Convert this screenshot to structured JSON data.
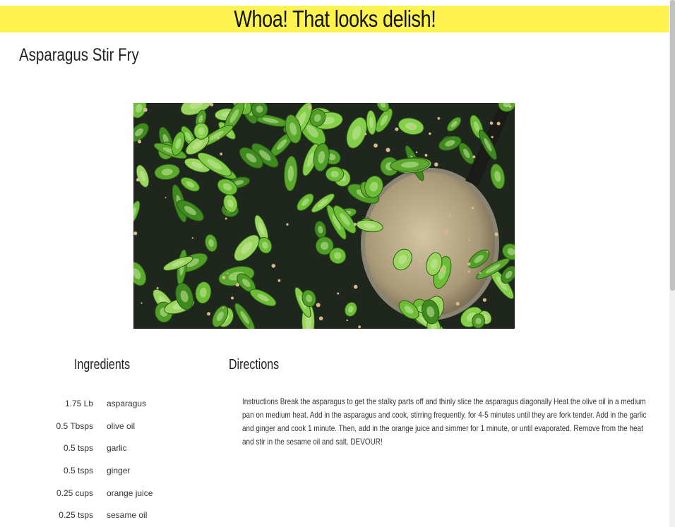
{
  "banner": {
    "text": "Whoa! That looks delish!"
  },
  "recipe": {
    "title": "Asparagus Stir Fry",
    "image_alt": "asparagus stir fry photo"
  },
  "ingredients": {
    "heading": "Ingredients",
    "items": [
      {
        "qty": "1.75 Lb",
        "name": "asparagus"
      },
      {
        "qty": "0.5 Tbsps",
        "name": "olive oil"
      },
      {
        "qty": "0.5 tsps",
        "name": "garlic"
      },
      {
        "qty": "0.5 tsps",
        "name": "ginger"
      },
      {
        "qty": "0.25 cups",
        "name": "orange juice"
      },
      {
        "qty": "0.25 tsps",
        "name": "sesame oil"
      }
    ]
  },
  "directions": {
    "heading": "Directions",
    "text": "Instructions Break the asparagus to get the stalky parts off and thinly slice the asparagus diagonally Heat the olive oil in a medium pan on medium heat. Add in the asparagus and cook, stirring frequently, for 4-5 minutes until they are fork tender. Add in the garlic and ginger and cook 1 minute. Then, add in the orange juice and simmer for 1 minute, or until evaporated. Remove from the heat and stir in the sesame oil and salt. DEVOUR!"
  },
  "colors": {
    "banner_bg": "#fff44f",
    "asparagus_green": "#5fae2e",
    "pan_dark": "#1f261d"
  }
}
